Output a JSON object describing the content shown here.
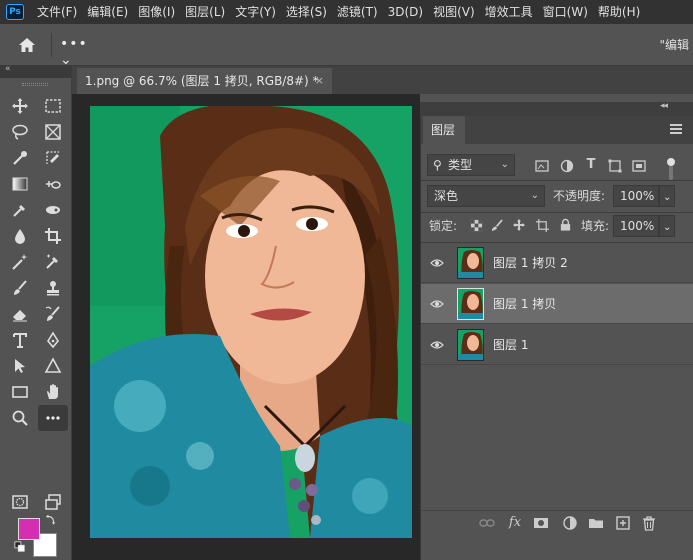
{
  "app": {
    "logo": "Ps"
  },
  "menu": [
    "文件(F)",
    "编辑(E)",
    "图像(I)",
    "图层(L)",
    "文字(Y)",
    "选择(S)",
    "滤镜(T)",
    "3D(D)",
    "视图(V)",
    "增效工具",
    "窗口(W)",
    "帮助(H)"
  ],
  "options_bar": {
    "more_label": "••• ⌄",
    "edit_label": "\"编辑"
  },
  "document": {
    "tab_title": "1.png @ 66.7% (图层 1 拷贝, RGB/8#) *",
    "close": "×"
  },
  "collapse_arrows": "«",
  "colors": {
    "foreground": "#d42fb0",
    "background": "#ffffff",
    "accent": "#31a8ff"
  },
  "tools": [
    "move-icon",
    "marquee-icon",
    "lasso-icon",
    "frame-icon",
    "quick-select-icon",
    "slice-icon",
    "gradient-icon",
    "content-aware-move-icon",
    "eyedropper-icon",
    "patch-icon",
    "blur-icon",
    "crop-icon",
    "magic-wand-icon",
    "color-sampler-icon",
    "brush-icon",
    "stamp-icon",
    "eraser-icon",
    "history-brush-icon",
    "type-icon",
    "pen-icon",
    "path-select-icon",
    "shape-icon",
    "rectangle-icon",
    "hand-icon",
    "zoom-icon",
    "more-tools-icon",
    "quick-mask-icon",
    "screen-mode-icon"
  ],
  "layers_panel": {
    "tab": "图层",
    "filter_kind": "类型",
    "blend_mode": "深色",
    "opacity_label": "不透明度:",
    "opacity_value": "100%",
    "lock_label": "锁定:",
    "fill_label": "填充:",
    "fill_value": "100%",
    "layers": [
      {
        "name": "图层 1 拷贝 2",
        "visible": true,
        "selected": false
      },
      {
        "name": "图层 1 拷贝",
        "visible": true,
        "selected": true
      },
      {
        "name": "图层 1",
        "visible": true,
        "selected": false
      }
    ],
    "footer_icons": [
      "link-icon",
      "fx-icon",
      "mask-icon",
      "adjustment-icon",
      "group-folder-icon",
      "new-layer-icon",
      "trash-icon"
    ],
    "fx_label": "fx"
  }
}
